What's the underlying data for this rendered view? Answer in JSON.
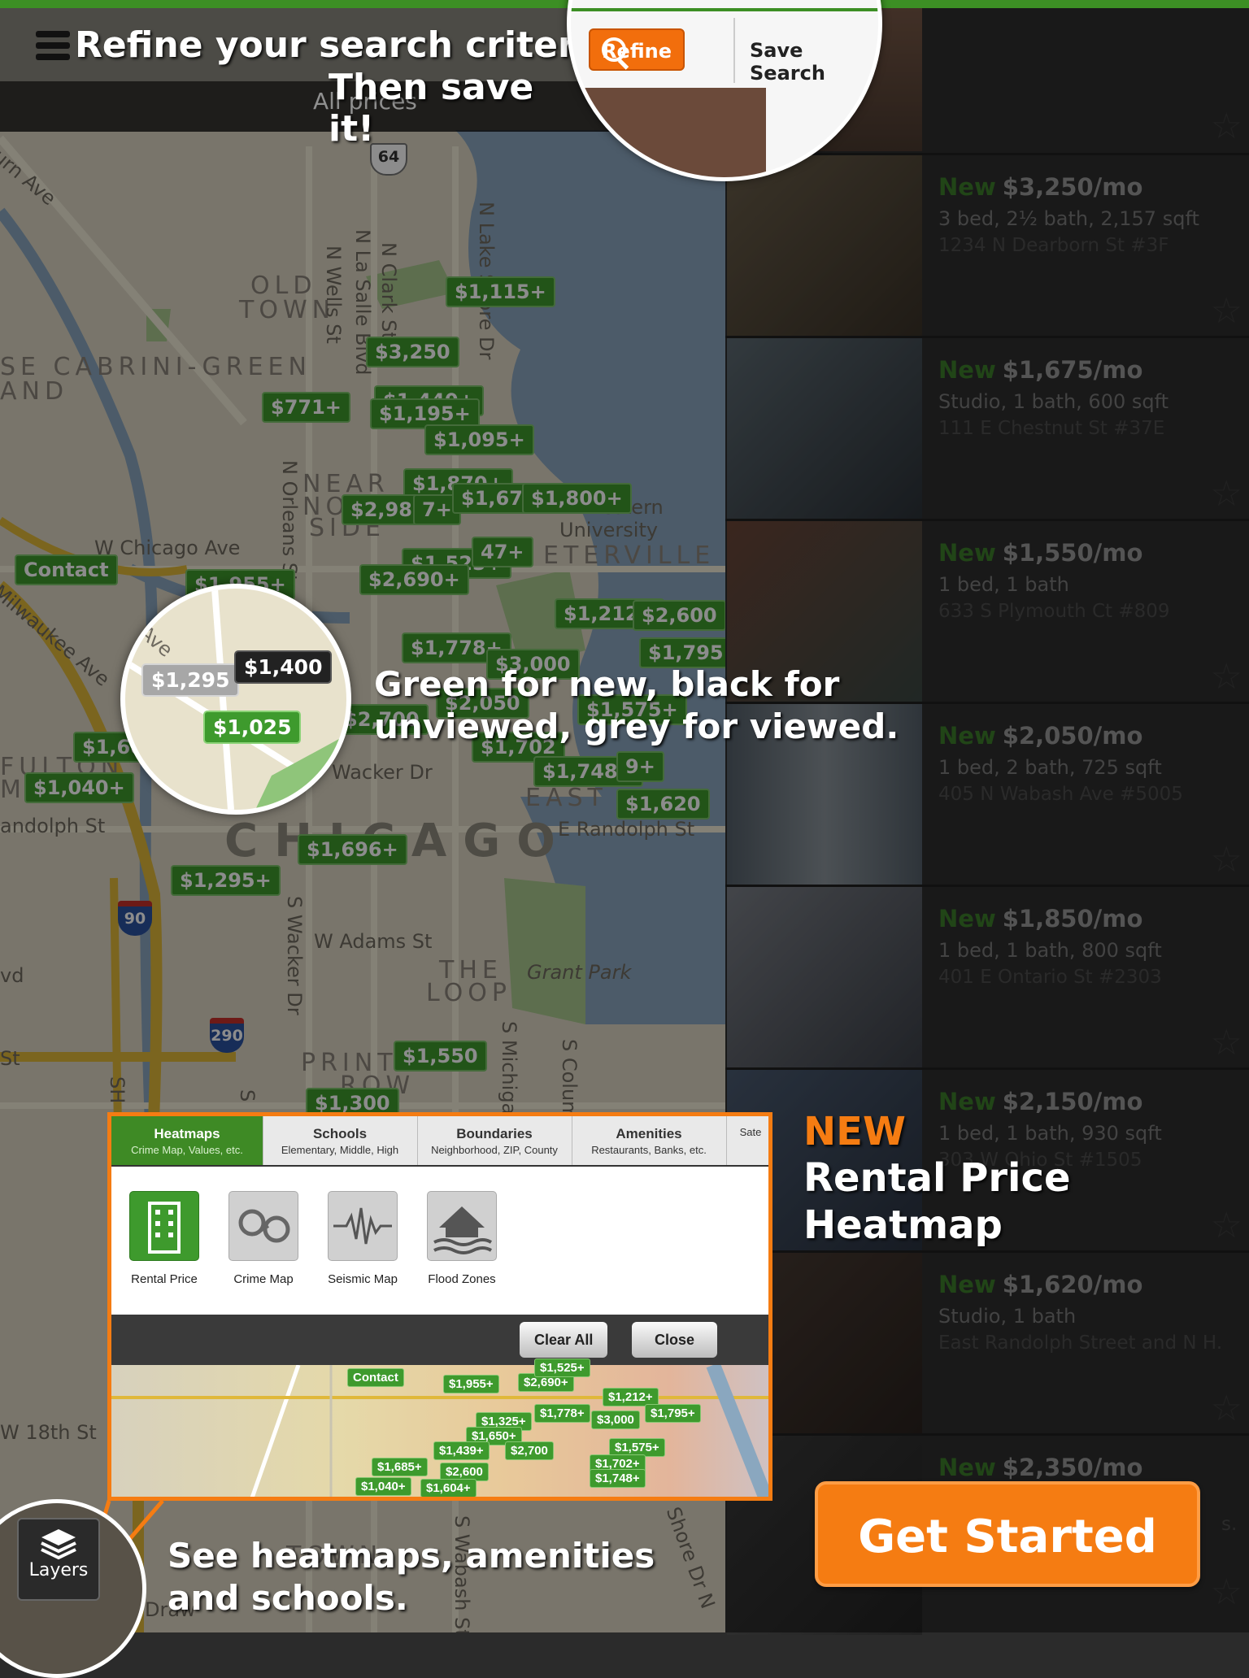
{
  "header": {
    "headline": "Refine your search criteria.",
    "subheadline": "Then save it!",
    "price_filter": "All prices",
    "refine_button": "Refine",
    "save_search_button": "Save Search"
  },
  "map": {
    "street_labels": [
      "urn Ave",
      "OLD",
      "TOWN",
      "N La Salle Blvd",
      "N Wells St",
      "N Clark St",
      "N Lake Shore Dr",
      "SE CABRINI-GREEN",
      "AND",
      "NEAR",
      "NO",
      "SIDE",
      "N Orleans St",
      "W Chicago Ave",
      "Milwaukee Ave",
      "western",
      "University",
      "ETERVILLE",
      "FULTON",
      "MA",
      "Wacker Dr",
      "andolph St",
      "EAST",
      "E Randolph St",
      "CHICAGO",
      "S Wacker Dr",
      "W Adams St",
      "THE",
      "LOOP",
      "Grant Park",
      "vd",
      "St",
      "PRINTE",
      "ROW",
      "S Michigan",
      "S Colum",
      "W 18th St",
      "SH",
      "S",
      "Shore Dr N",
      "S Wabash St",
      "TOWN",
      "Draw"
    ],
    "highway_shields": [
      "64",
      "90",
      "290"
    ],
    "price_pins": [
      "$1,115+",
      "$3,250",
      "$1,440+",
      "$771+",
      "$1,195+",
      "$1,095+",
      "$1,870+",
      "$2,980",
      "7+",
      "$1,675",
      "$1,800+",
      "$1,525+",
      "47+",
      "$1,955+",
      "$2,690+",
      "Contact",
      "$1,212+",
      "$2,600",
      "$1,778+",
      "$3,000",
      "$1,795+",
      "$2,050",
      "$1,575+",
      "$2,700",
      "$1,68",
      "$1,040+",
      "$1,702",
      "$1,748+",
      "9+",
      "$1,620",
      "$1,696+",
      "$1,295+",
      "$1,550",
      "$1,300"
    ]
  },
  "legend_bubble": {
    "pins": [
      "$1,295",
      "$1,400",
      "$1,025"
    ],
    "label": "Ave",
    "caption": "Green for new, black for unviewed, grey for viewed."
  },
  "listings": [
    {
      "new": "New",
      "price": "$3,250/mo",
      "details": "3 bed, 2½ bath, 2,157 sqft",
      "address": "1234 N Dearborn St #3F"
    },
    {
      "new": "New",
      "price": "$1,675/mo",
      "details": "Studio, 1 bath, 600 sqft",
      "address": "111 E Chestnut St #37E"
    },
    {
      "new": "New",
      "price": "$1,550/mo",
      "details": "1 bed, 1 bath",
      "address": "633 S Plymouth Ct #809"
    },
    {
      "new": "New",
      "price": "$2,050/mo",
      "details": "1 bed, 2 bath, 725 sqft",
      "address": "405 N Wabash Ave #5005"
    },
    {
      "new": "New",
      "price": "$1,850/mo",
      "details": "1 bed, 1 bath, 800 sqft",
      "address": "401 E Ontario St #2303"
    },
    {
      "new": "New",
      "price": "$2,150/mo",
      "details": "1 bed, 1 bath, 930 sqft",
      "address": "303 W Ohio St #1505"
    },
    {
      "new": "New",
      "price": "$1,620/mo",
      "details": "Studio, 1 bath",
      "address": "East Randolph Street and N H."
    },
    {
      "new": "New",
      "price": "$2,350/mo",
      "details": "",
      "address": "s."
    }
  ],
  "heatmap_panel": {
    "tabs": [
      {
        "title": "Heatmaps",
        "subtitle": "Crime Map, Values, etc."
      },
      {
        "title": "Schools",
        "subtitle": "Elementary, Middle, High"
      },
      {
        "title": "Boundaries",
        "subtitle": "Neighborhood, ZIP, County"
      },
      {
        "title": "Amenities",
        "subtitle": "Restaurants, Banks, etc."
      },
      {
        "title": "",
        "subtitle": "Sate"
      }
    ],
    "layers": [
      "Rental Price",
      "Crime Map",
      "Seismic Map",
      "Flood Zones"
    ],
    "clear_all_button": "Clear All",
    "close_button": "Close",
    "preview_pins": [
      "Contact",
      "$1,955+",
      "$2,690+",
      "$1,525+",
      "$1,212+",
      "$1,778+",
      "$3,000",
      "$1,795+",
      "$1,325+",
      "$1,650+",
      "$1,439+",
      "$2,700",
      "$1,575+",
      "$1,685+",
      "$2,600",
      "$1,702+",
      "$1,748+",
      "$1,040+",
      "$1,604+"
    ]
  },
  "heatmap_promo": {
    "badge": "NEW",
    "line1": "Rental Price",
    "line2": "Heatmap"
  },
  "layers_button": "Layers",
  "bottom_caption": {
    "line1": "See heatmaps, amenities",
    "line2": "and schools."
  },
  "cta": {
    "label": "Get Started"
  },
  "colors": {
    "accent": "#f57c12",
    "new_green": "#3e9a2d",
    "brand_green": "#3c8f24"
  }
}
